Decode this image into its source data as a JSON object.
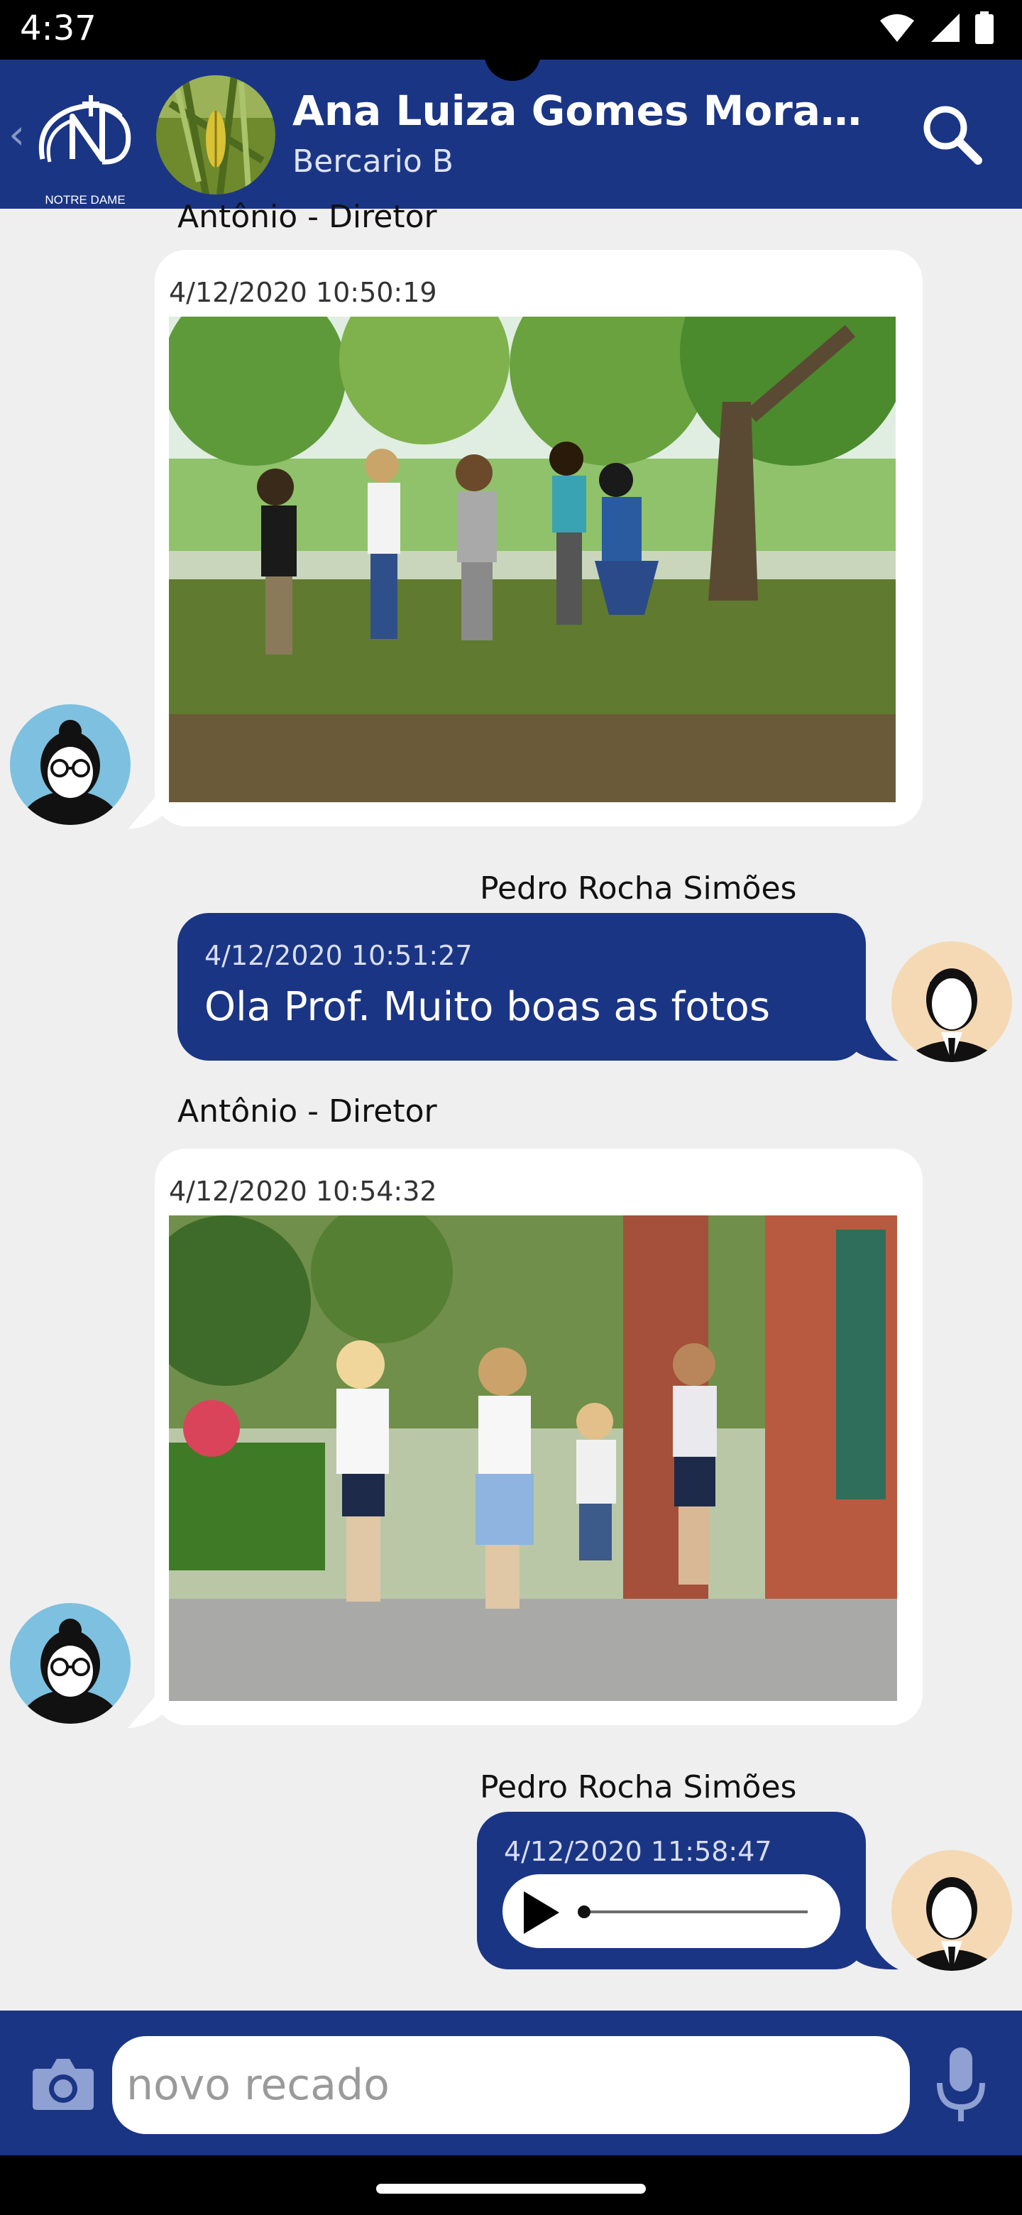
{
  "status_bar": {
    "time": "4:37"
  },
  "header": {
    "logo_text": "NOTRE DAME",
    "contact_name": "Ana Luiza Gomes Moraes…",
    "contact_subtitle": "Bercario B"
  },
  "colors": {
    "primary": "#1b3585",
    "background": "#efefef",
    "bubble_in": "#ffffff"
  },
  "messages": [
    {
      "sender": "Antônio - Diretor",
      "direction": "incoming",
      "timestamp": "4/12/2020 10:50:19",
      "type": "photo"
    },
    {
      "sender": "Pedro Rocha Simões",
      "direction": "outgoing",
      "timestamp": "4/12/2020 10:51:27",
      "type": "text",
      "text": "Ola Prof. Muito boas as fotos"
    },
    {
      "sender": "Antônio - Diretor",
      "direction": "incoming",
      "timestamp": "4/12/2020 10:54:32",
      "type": "photo"
    },
    {
      "sender": "Pedro Rocha Simões",
      "direction": "outgoing",
      "timestamp": "4/12/2020 11:58:47",
      "type": "audio"
    }
  ],
  "input": {
    "placeholder": "novo recado"
  },
  "icons": {
    "back": "chevron-left-icon",
    "search": "search-icon",
    "camera": "camera-icon",
    "mic": "microphone-icon",
    "play": "play-icon"
  }
}
